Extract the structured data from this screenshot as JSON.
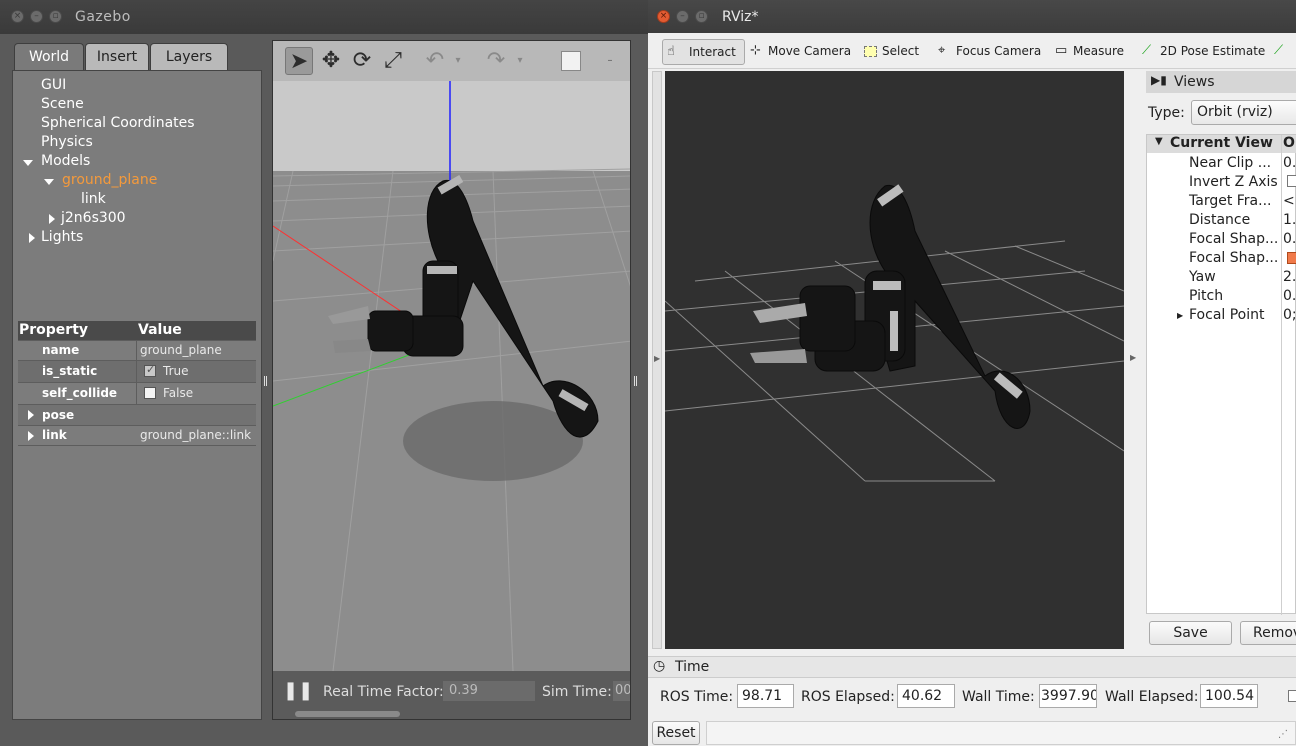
{
  "gazebo": {
    "title": "Gazebo",
    "tabs": [
      {
        "label": "World"
      },
      {
        "label": "Insert"
      },
      {
        "label": "Layers"
      }
    ],
    "tree": {
      "gui": "GUI",
      "scene": "Scene",
      "spherical": "Spherical Coordinates",
      "physics": "Physics",
      "models": "Models",
      "ground_plane": "ground_plane",
      "link": "link",
      "j2n6s300": "j2n6s300",
      "lights": "Lights"
    },
    "properties": {
      "header_property": "Property",
      "header_value": "Value",
      "rows": [
        {
          "key": "name",
          "value": "ground_plane"
        },
        {
          "key": "is_static",
          "value": "True"
        },
        {
          "key": "self_collide",
          "value": "False"
        },
        {
          "key": "pose",
          "value": ""
        },
        {
          "key": "link",
          "value": "ground_plane::link"
        }
      ]
    },
    "bottom": {
      "real_time_factor_label": "Real Time Factor:",
      "real_time_factor": "0.39",
      "sim_time_label": "Sim Time:",
      "sim_time": "00"
    }
  },
  "rviz": {
    "title": "RViz*",
    "tools": [
      {
        "label": "Interact"
      },
      {
        "label": "Move Camera"
      },
      {
        "label": "Select"
      },
      {
        "label": "Focus Camera"
      },
      {
        "label": "Measure"
      },
      {
        "label": "2D Pose Estimate"
      }
    ],
    "views_panel": {
      "title": "Views",
      "type_label": "Type:",
      "type_value": "Orbit (rviz)",
      "current_view": "Current View",
      "current_view_col2": "O",
      "props": [
        {
          "name": "Near Clip ...",
          "value": "0."
        },
        {
          "name": "Invert Z Axis",
          "value": ""
        },
        {
          "name": "Target Fra...",
          "value": "<F"
        },
        {
          "name": "Distance",
          "value": "1."
        },
        {
          "name": "Focal Shap...",
          "value": "0."
        },
        {
          "name": "Focal Shap...",
          "value": ""
        },
        {
          "name": "Yaw",
          "value": "2."
        },
        {
          "name": "Pitch",
          "value": "0."
        },
        {
          "name": "Focal Point",
          "value": "0;"
        }
      ],
      "save_label": "Save",
      "remove_label": "Remov"
    },
    "time": {
      "header": "Time",
      "ros_time_label": "ROS Time:",
      "ros_time": "98.71",
      "ros_elapsed_label": "ROS Elapsed:",
      "ros_elapsed": "40.62",
      "wall_time_label": "Wall Time:",
      "wall_time": "3997.90",
      "wall_elapsed_label": "Wall Elapsed:",
      "wall_elapsed": "100.54"
    },
    "reset_label": "Reset"
  },
  "colors": {
    "selected_tree_item": "#f49a3c",
    "rviz_viewport_bg": "#303030",
    "gazebo_panel_bg": "#7c7c7c"
  }
}
